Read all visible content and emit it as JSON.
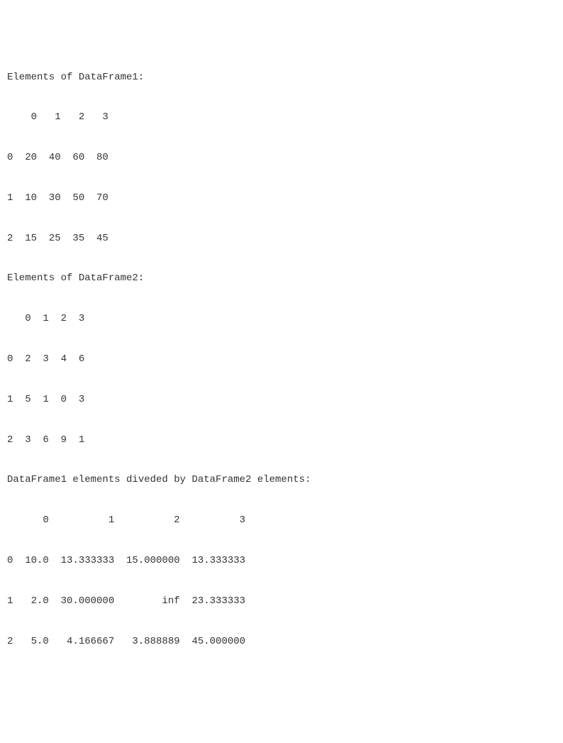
{
  "lines": {
    "df1_title": "Elements of DataFrame1:",
    "df1_header": "    0   1   2   3",
    "df1_r0": "0  20  40  60  80",
    "df1_r1": "1  10  30  50  70",
    "df1_r2": "2  15  25  35  45",
    "df2_title": "Elements of DataFrame2:",
    "df2_header": "   0  1  2  3",
    "df2_r0": "0  2  3  4  6",
    "df2_r1": "1  5  1  0  3",
    "df2_r2": "2  3  6  9  1",
    "div_title": "DataFrame1 elements diveded by DataFrame2 elements:",
    "div_header": "      0          1          2          3",
    "div_r0": "0  10.0  13.333333  15.000000  13.333333",
    "div_r1": "1   2.0  30.000000        inf  23.333333",
    "div_r2": "2   5.0   4.166667   3.888889  45.000000"
  },
  "chart_data": [
    {
      "type": "table",
      "title": "Elements of DataFrame1:",
      "columns": [
        "0",
        "1",
        "2",
        "3"
      ],
      "index": [
        "0",
        "1",
        "2"
      ],
      "rows": [
        [
          20,
          40,
          60,
          80
        ],
        [
          10,
          30,
          50,
          70
        ],
        [
          15,
          25,
          35,
          45
        ]
      ]
    },
    {
      "type": "table",
      "title": "Elements of DataFrame2:",
      "columns": [
        "0",
        "1",
        "2",
        "3"
      ],
      "index": [
        "0",
        "1",
        "2"
      ],
      "rows": [
        [
          2,
          3,
          4,
          6
        ],
        [
          5,
          1,
          0,
          3
        ],
        [
          3,
          6,
          9,
          1
        ]
      ]
    },
    {
      "type": "table",
      "title": "DataFrame1 elements diveded by DataFrame2 elements:",
      "columns": [
        "0",
        "1",
        "2",
        "3"
      ],
      "index": [
        "0",
        "1",
        "2"
      ],
      "rows": [
        [
          10.0,
          13.333333,
          15.0,
          13.333333
        ],
        [
          2.0,
          30.0,
          "inf",
          23.333333
        ],
        [
          5.0,
          4.166667,
          3.888889,
          45.0
        ]
      ]
    }
  ]
}
